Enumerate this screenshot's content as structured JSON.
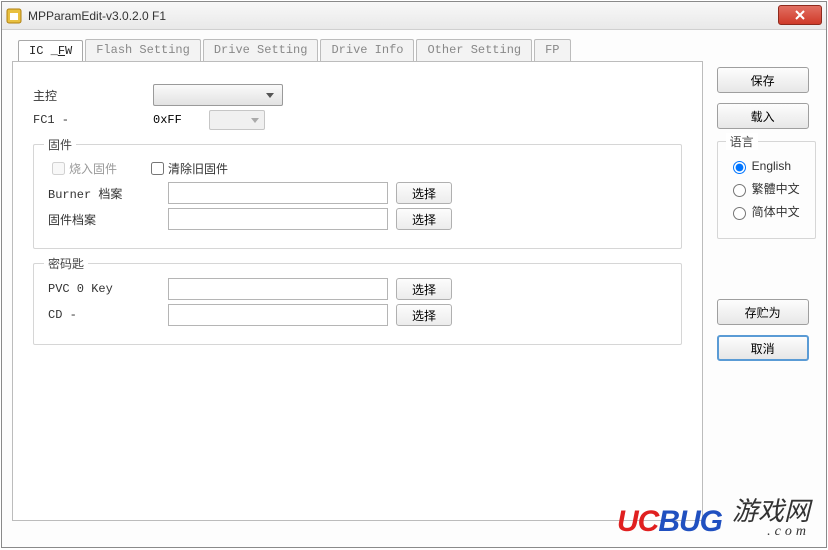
{
  "window": {
    "title": "MPParamEdit-v3.0.2.0 F1"
  },
  "tabs": [
    {
      "id": "ic-fw",
      "label": "IC _FW",
      "active": true,
      "underline_last": true
    },
    {
      "id": "flash-setting",
      "label": "Flash Setting"
    },
    {
      "id": "drive-setting",
      "label": "Drive Setting"
    },
    {
      "id": "drive-info",
      "label": "Drive Info"
    },
    {
      "id": "other-setting",
      "label": "Other Setting"
    },
    {
      "id": "fp",
      "label": "FP"
    }
  ],
  "main": {
    "controller_label": "主控",
    "fc1_label": "FC1 -",
    "fc1_value": "0xFF",
    "firmware": {
      "legend": "固件",
      "burn_checkbox": "烧入固件",
      "clear_checkbox": "清除旧固件",
      "burner_label": "Burner 档案",
      "firmware_label": "固件档案",
      "select_btn": "选择"
    },
    "keys": {
      "legend": "密码匙",
      "pvc_label": "PVC 0 Key",
      "cd_label": "CD -",
      "select_btn": "选择"
    }
  },
  "side": {
    "save": "保存",
    "load": "载入",
    "save_as": "存贮为",
    "cancel": "取消",
    "language": {
      "legend": "语言",
      "options": [
        "English",
        "繁體中文",
        "简体中文"
      ],
      "selected": "English"
    }
  },
  "watermark": {
    "logo_uc": "UC",
    "logo_bug": "BUG",
    "text": "游戏网",
    "com": ".com"
  }
}
